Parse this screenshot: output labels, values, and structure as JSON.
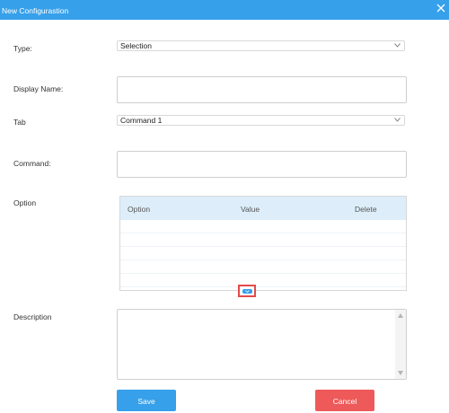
{
  "dialog": {
    "title": "New Configurastion",
    "close_icon": "close-icon",
    "accent_color": "#36a0ea"
  },
  "form": {
    "type": {
      "label": "Type:",
      "value": "Selection"
    },
    "display_name": {
      "label": "Display Name:",
      "value": ""
    },
    "tab": {
      "label": "Tab",
      "value": "Command 1"
    },
    "command": {
      "label": "Command:",
      "value": ""
    },
    "option": {
      "label": "Option",
      "columns": [
        "Option",
        "Value",
        "Delete"
      ],
      "rows": []
    },
    "description": {
      "label": "Description",
      "value": ""
    }
  },
  "buttons": {
    "save": "Save",
    "cancel": "Cancel",
    "save_color": "#36a0ea",
    "cancel_color": "#ee5959"
  }
}
